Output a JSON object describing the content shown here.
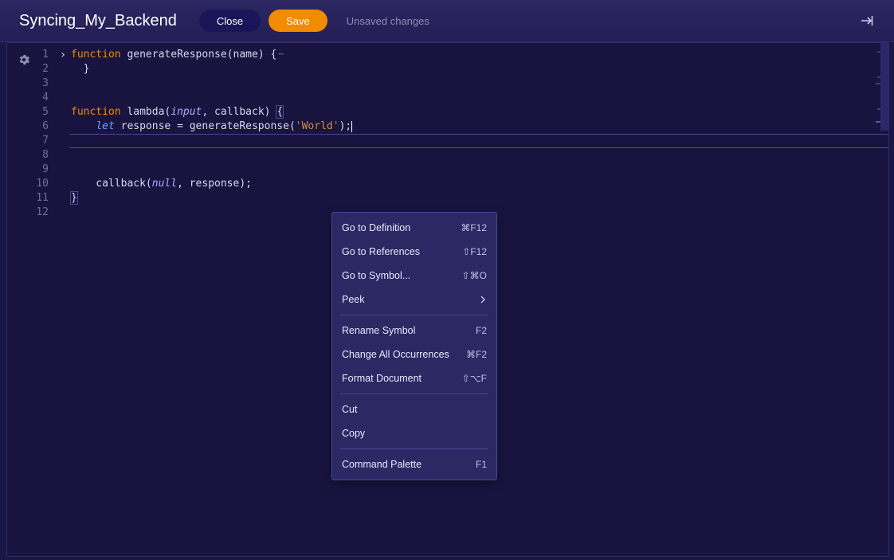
{
  "header": {
    "title": "Syncing_My_Backend",
    "close_label": "Close",
    "save_label": "Save",
    "status_text": "Unsaved changes"
  },
  "editor": {
    "line_numbers": [
      "1",
      "2",
      "3",
      "4",
      "5",
      "6",
      "7",
      "8",
      "9",
      "10",
      "11",
      "12"
    ],
    "highlighted_line_index": 6,
    "code": {
      "l1": {
        "kw": "function",
        "name": " generateResponse",
        "sig": "(name) {"
      },
      "l2": "  }",
      "l3": "",
      "l4": "",
      "l5": {
        "kw": "function",
        "name": " lambda",
        "sig_open": "(",
        "p1": "input",
        "comma": ", callback) ",
        "brace": "{"
      },
      "l6": {
        "indent": "    ",
        "let": "let",
        "rest": " response = generateResponse(",
        "str": "'World'",
        "tail": ");"
      },
      "l7": "",
      "l8": "",
      "l9": "",
      "l10": {
        "indent": "    callback(",
        "null": "null",
        "tail": ", response);"
      },
      "l11": "}"
    }
  },
  "context_menu": {
    "groups": [
      [
        {
          "label": "Go to Definition",
          "shortcut": "⌘F12"
        },
        {
          "label": "Go to References",
          "shortcut": "⇧F12"
        },
        {
          "label": "Go to Symbol...",
          "shortcut": "⇧⌘O"
        },
        {
          "label": "Peek",
          "submenu": true
        }
      ],
      [
        {
          "label": "Rename Symbol",
          "shortcut": "F2"
        },
        {
          "label": "Change All Occurrences",
          "shortcut": "⌘F2"
        },
        {
          "label": "Format Document",
          "shortcut": "⇧⌥F"
        }
      ],
      [
        {
          "label": "Cut"
        },
        {
          "label": "Copy"
        }
      ],
      [
        {
          "label": "Command Palette",
          "shortcut": "F1"
        }
      ]
    ]
  }
}
